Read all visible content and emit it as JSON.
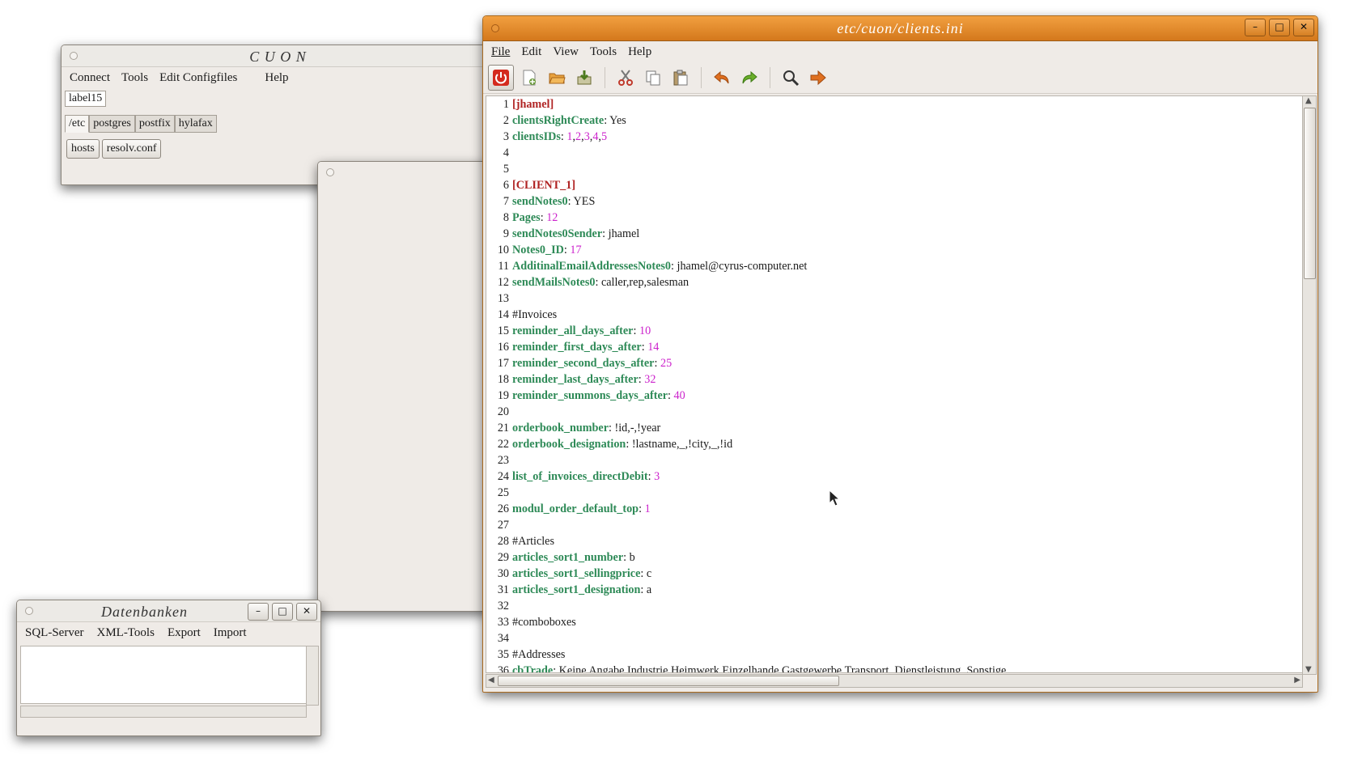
{
  "cuon": {
    "title": "C U O N",
    "menu": [
      "Connect",
      "Tools",
      "Edit Configfiles",
      "Help"
    ],
    "label": "label15",
    "tabs": [
      "/etc",
      "postgres",
      "postfix",
      "hylafax"
    ],
    "subtabs": [
      "hosts",
      "resolv.conf"
    ]
  },
  "daten": {
    "title": "Datenbanken",
    "menu": [
      "SQL-Server",
      "XML-Tools",
      "Export",
      "Import"
    ]
  },
  "editor": {
    "title": "etc/cuon/clients.ini",
    "menu": [
      "File",
      "Edit",
      "View",
      "Tools",
      "Help"
    ],
    "toolbar": [
      {
        "icon": "power-icon",
        "color": "#d42a1e"
      },
      {
        "icon": "new-file-icon",
        "color": "#6a9a3a"
      },
      {
        "icon": "open-folder-icon",
        "color": "#d98b2b"
      },
      {
        "icon": "save-icon",
        "color": "#7a8a30"
      },
      {
        "icon": "cut-icon",
        "color": "#c0392b"
      },
      {
        "icon": "copy-icon",
        "color": "#666666"
      },
      {
        "icon": "paste-icon",
        "color": "#7a6a4a"
      },
      {
        "icon": "undo-icon",
        "color": "#e07020"
      },
      {
        "icon": "redo-icon",
        "color": "#5a9e2a"
      },
      {
        "icon": "search-icon",
        "color": "#333333"
      },
      {
        "icon": "forward-icon",
        "color": "#e07020"
      }
    ],
    "lines": [
      [
        {
          "t": "[jhamel]",
          "c": "section"
        }
      ],
      [
        {
          "t": "clientsRightCreate",
          "c": "key"
        },
        {
          "t": ": Yes",
          "c": "text"
        }
      ],
      [
        {
          "t": "clientsIDs",
          "c": "key"
        },
        {
          "t": ": ",
          "c": "text"
        },
        {
          "t": "1",
          "c": "num"
        },
        {
          "t": ",",
          "c": "text"
        },
        {
          "t": "2",
          "c": "num"
        },
        {
          "t": ",",
          "c": "text"
        },
        {
          "t": "3",
          "c": "num"
        },
        {
          "t": ",",
          "c": "text"
        },
        {
          "t": "4",
          "c": "num"
        },
        {
          "t": ",",
          "c": "text"
        },
        {
          "t": "5",
          "c": "num"
        }
      ],
      [],
      [],
      [
        {
          "t": "[CLIENT_1]",
          "c": "section"
        }
      ],
      [
        {
          "t": "sendNotes0",
          "c": "key"
        },
        {
          "t": ": YES",
          "c": "text"
        }
      ],
      [
        {
          "t": "Pages",
          "c": "key"
        },
        {
          "t": ": ",
          "c": "text"
        },
        {
          "t": "12",
          "c": "num"
        }
      ],
      [
        {
          "t": "sendNotes0Sender",
          "c": "key"
        },
        {
          "t": ": jhamel",
          "c": "text"
        }
      ],
      [
        {
          "t": "Notes0_ID",
          "c": "key"
        },
        {
          "t": ": ",
          "c": "text"
        },
        {
          "t": "17",
          "c": "num"
        }
      ],
      [
        {
          "t": "AdditinalEmailAddressesNotes0",
          "c": "key"
        },
        {
          "t": ": jhamel@cyrus-computer.net",
          "c": "text"
        }
      ],
      [
        {
          "t": "sendMailsNotes0",
          "c": "key"
        },
        {
          "t": ": caller,rep,salesman",
          "c": "text"
        }
      ],
      [],
      [
        {
          "t": "#Invoices",
          "c": "comment"
        }
      ],
      [
        {
          "t": "reminder_all_days_after",
          "c": "key"
        },
        {
          "t": ": ",
          "c": "text"
        },
        {
          "t": "10",
          "c": "num"
        }
      ],
      [
        {
          "t": "reminder_first_days_after",
          "c": "key"
        },
        {
          "t": ": ",
          "c": "text"
        },
        {
          "t": "14",
          "c": "num"
        }
      ],
      [
        {
          "t": "reminder_second_days_after",
          "c": "key"
        },
        {
          "t": ": ",
          "c": "text"
        },
        {
          "t": "25",
          "c": "num"
        }
      ],
      [
        {
          "t": "reminder_last_days_after",
          "c": "key"
        },
        {
          "t": ": ",
          "c": "text"
        },
        {
          "t": "32",
          "c": "num"
        }
      ],
      [
        {
          "t": "reminder_summons_days_after",
          "c": "key"
        },
        {
          "t": ": ",
          "c": "text"
        },
        {
          "t": "40",
          "c": "num"
        }
      ],
      [],
      [
        {
          "t": "orderbook_number",
          "c": "key"
        },
        {
          "t": ": !id,-,!year",
          "c": "text"
        }
      ],
      [
        {
          "t": "orderbook_designation",
          "c": "key"
        },
        {
          "t": ": !lastname,_,!city,_,!id",
          "c": "text"
        }
      ],
      [],
      [
        {
          "t": "list_of_invoices_directDebit",
          "c": "key"
        },
        {
          "t": ": ",
          "c": "text"
        },
        {
          "t": "3",
          "c": "num"
        }
      ],
      [],
      [
        {
          "t": "modul_order_default_top",
          "c": "key"
        },
        {
          "t": ": ",
          "c": "text"
        },
        {
          "t": "1",
          "c": "num"
        }
      ],
      [],
      [
        {
          "t": "#Articles",
          "c": "comment"
        }
      ],
      [
        {
          "t": "articles_sort1_number",
          "c": "key"
        },
        {
          "t": ": b",
          "c": "text"
        }
      ],
      [
        {
          "t": "articles_sort1_sellingprice",
          "c": "key"
        },
        {
          "t": ": c",
          "c": "text"
        }
      ],
      [
        {
          "t": "articles_sort1_designation",
          "c": "key"
        },
        {
          "t": ": a",
          "c": "text"
        }
      ],
      [],
      [
        {
          "t": "#comboboxes",
          "c": "comment"
        }
      ],
      [],
      [
        {
          "t": "#Addresses",
          "c": "comment"
        }
      ],
      [
        {
          "t": "cbTrade",
          "c": "key"
        },
        {
          "t": ": Keine Angabe,Industrie,Heimwerk,Einzelhande,Gastgewerbe,Transport, Dienstleistung, Sonstige",
          "c": "text"
        }
      ]
    ]
  },
  "colors": {
    "editor_titlebar": "#e08a2a",
    "section": "#b02424",
    "key": "#2e8a57",
    "number": "#cc22cc"
  }
}
